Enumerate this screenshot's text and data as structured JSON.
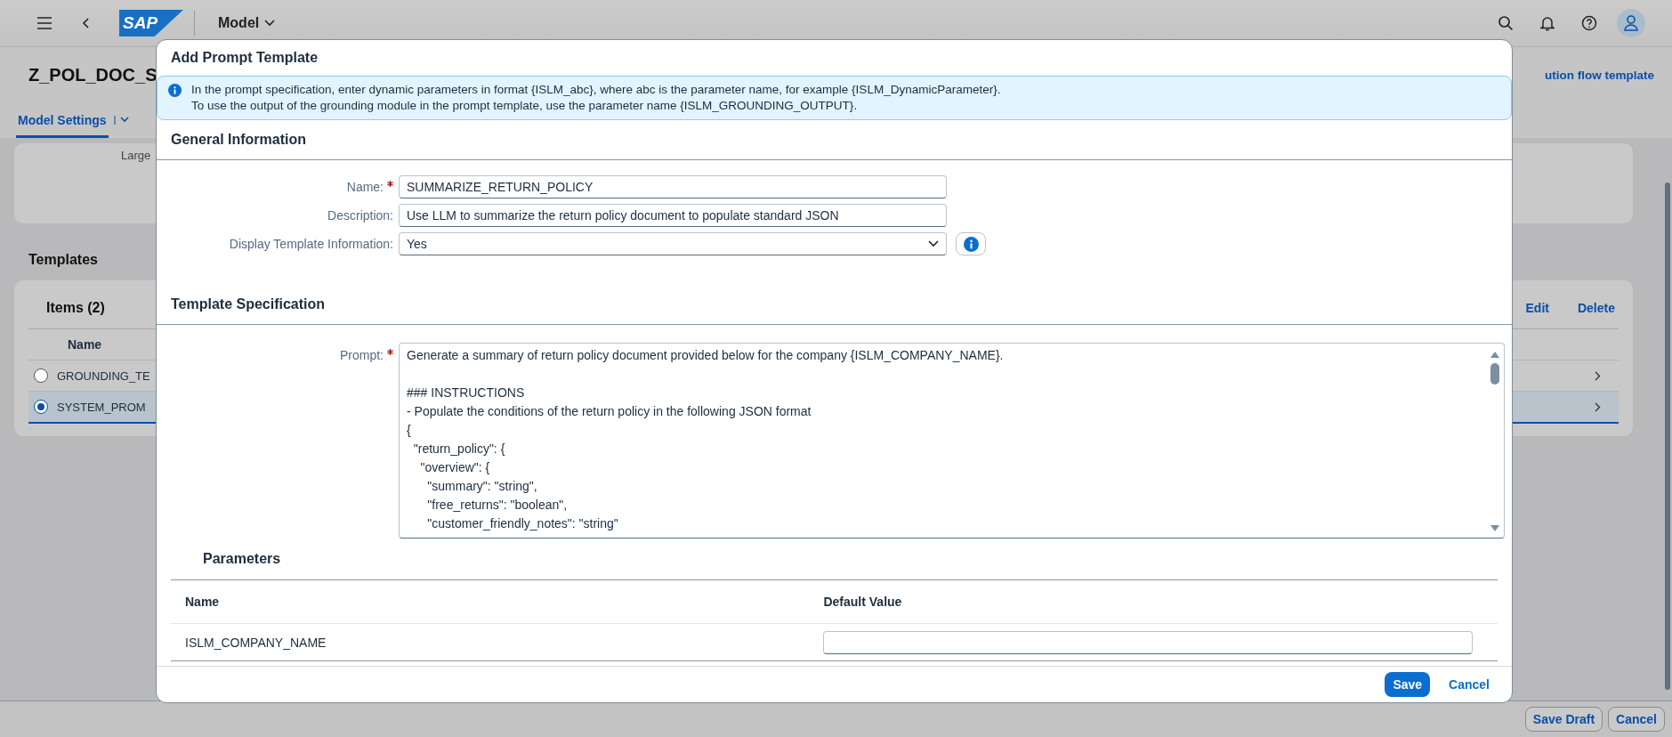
{
  "shell_bar": {
    "logo": "SAP",
    "title": "Model"
  },
  "page": {
    "title": "Z_POL_DOC_S",
    "right_link": "ution flow template",
    "tabs": [
      {
        "label": "Model Settings",
        "selected": true
      }
    ],
    "section_text": "Large",
    "templates_heading": "Templates",
    "items_title": "Items (2)",
    "actions": [
      "Edit",
      "Delete"
    ],
    "columns": [
      "Name"
    ],
    "rows": [
      {
        "name": "GROUNDING_TE",
        "selected": false
      },
      {
        "name": "SYSTEM_PROM",
        "selected": true
      }
    ]
  },
  "footer": {
    "buttons": [
      "Save Draft",
      "Cancel"
    ]
  },
  "dialog": {
    "title": "Add Prompt Template",
    "info_lines": [
      "In the prompt specification, enter dynamic parameters in format {ISLM_abc}, where abc is the parameter name, for example {ISLM_DynamicParameter}.",
      "To use the output of the grounding module in the prompt template, use the parameter name {ISLM_GROUNDING_OUTPUT}."
    ],
    "general": {
      "heading": "General Information",
      "fields": [
        {
          "label": "Name:",
          "required": true,
          "kind": "input",
          "value": "SUMMARIZE_RETURN_POLICY"
        },
        {
          "label": "Description:",
          "required": false,
          "kind": "input",
          "value": "Use LLM to summarize the return policy document to populate standard JSON"
        },
        {
          "label": "Display Template Information:",
          "required": false,
          "kind": "select",
          "value": "Yes"
        }
      ]
    },
    "spec": {
      "heading": "Template Specification",
      "prompt": {
        "label": "Prompt:",
        "required": true,
        "value": "Generate a summary of return policy document provided below for the company {ISLM_COMPANY_NAME}.\n\n### INSTRUCTIONS\n- Populate the conditions of the return policy in the following JSON format\n{\n  \"return_policy\": {\n    \"overview\": {\n      \"summary\": \"string\",\n      \"free_returns\": \"boolean\",\n      \"customer_friendly_notes\": \"string\""
      }
    },
    "parameters": {
      "heading": "Parameters",
      "columns": [
        "Name",
        "Default Value"
      ],
      "rows": [
        {
          "name": "ISLM_COMPANY_NAME"
        }
      ]
    },
    "buttons": [
      {
        "label": "Save",
        "kind": "primary"
      },
      {
        "label": "Cancel",
        "kind": "transparent"
      }
    ]
  }
}
